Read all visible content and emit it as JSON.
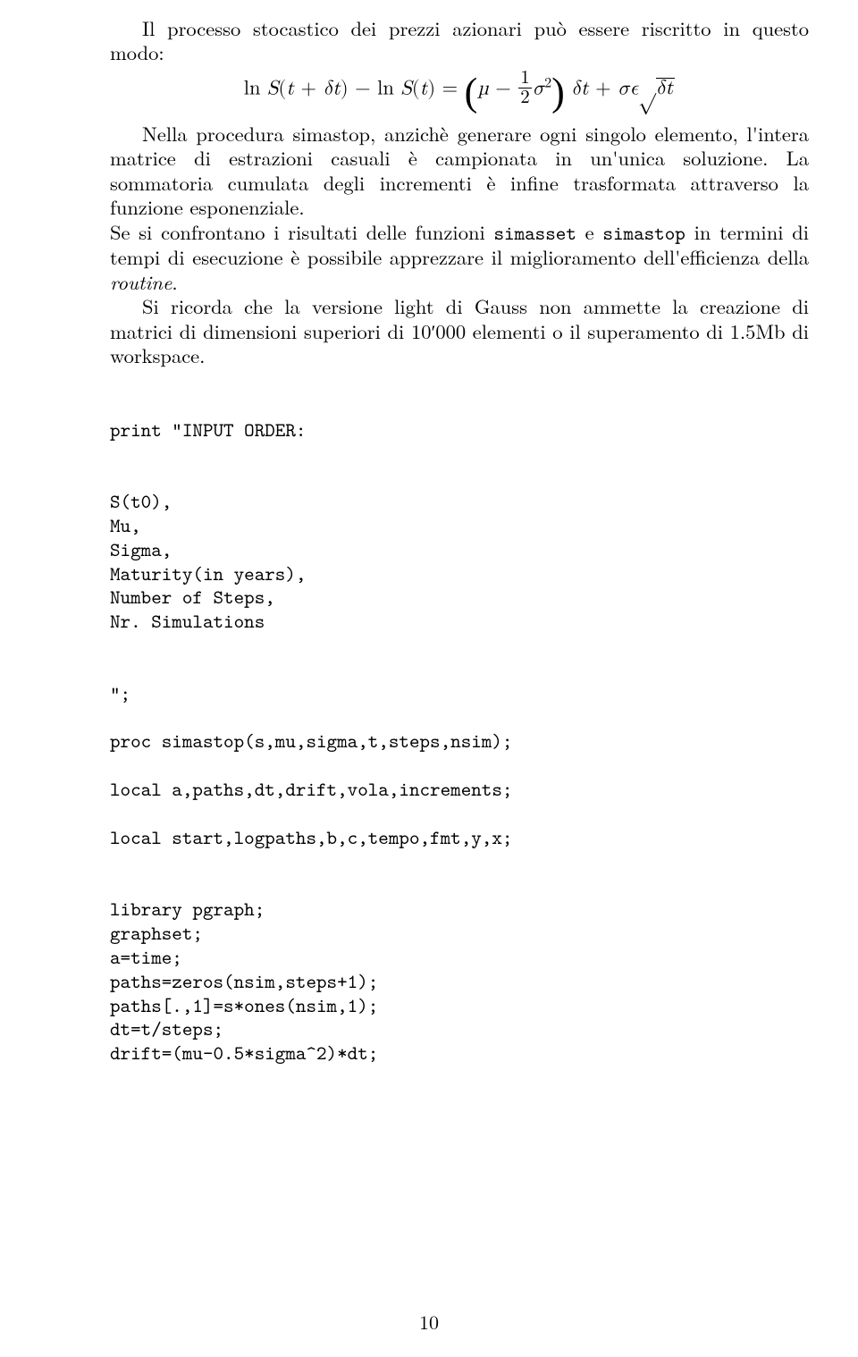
{
  "para1_pre": "Il processo stocastico dei prezzi azionari può essere riscritto in questo modo:",
  "equation": {
    "lhs_pre": "ln ",
    "var_S1": "S",
    "open1": "(",
    "t1": "t",
    "plus1": " + ",
    "dt1": "δt",
    "close1": ")",
    "minus": " − ln ",
    "var_S2": "S",
    "open2": "(",
    "t2": "t",
    "close2": ") = ",
    "lparen": "(",
    "mu": "µ",
    "minus2": " − ",
    "frac_num": "1",
    "frac_den": "2",
    "sigma": "σ",
    "sq": "2",
    "rparen": ")",
    "space": " ",
    "dt2": "δt",
    "plus2": " + ",
    "sigma2": "σϵ",
    "sqrt": "√",
    "dt3": "δt"
  },
  "para2": "Nella procedura simastop, anzichè generare ogni singolo elemento, l'intera matrice di estrazioni casuali è campionata in un'unica soluzione. La sommatoria cumulata degli incrementi è infine trasformata attraverso la funzione esponenziale.",
  "para3_a": "Se si confrontano i risultati delle funzioni ",
  "para3_tt1": "simasset",
  "para3_b": " e ",
  "para3_tt2": "simastop",
  "para3_c": " in termini di tempi di esecuzione è possibile apprezzare il miglioramento dell'efficienza della ",
  "para3_it": "routine",
  "para3_d": ".",
  "para4": "Si ricorda che la versione light di Gauss non ammette la creazione di matrici di dimensioni superiori di 10′000 elementi o il superamento di 1.5Mb di workspace.",
  "code": "print \"INPUT ORDER:\n\n\nS(t0),\nMu,\nSigma,\nMaturity(in years),\nNumber of Steps,\nNr. Simulations\n\n\n\";\n\nproc simastop(s,mu,sigma,t,steps,nsim);\n\nlocal a,paths,dt,drift,vola,increments;\n\nlocal start,logpaths,b,c,tempo,fmt,y,x;\n\n\nlibrary pgraph;\ngraphset;\na=time;\npaths=zeros(nsim,steps+1);\npaths[.,1]=s*ones(nsim,1);\ndt=t/steps;\ndrift=(mu-0.5*sigma^2)*dt;",
  "pagenum": "10"
}
